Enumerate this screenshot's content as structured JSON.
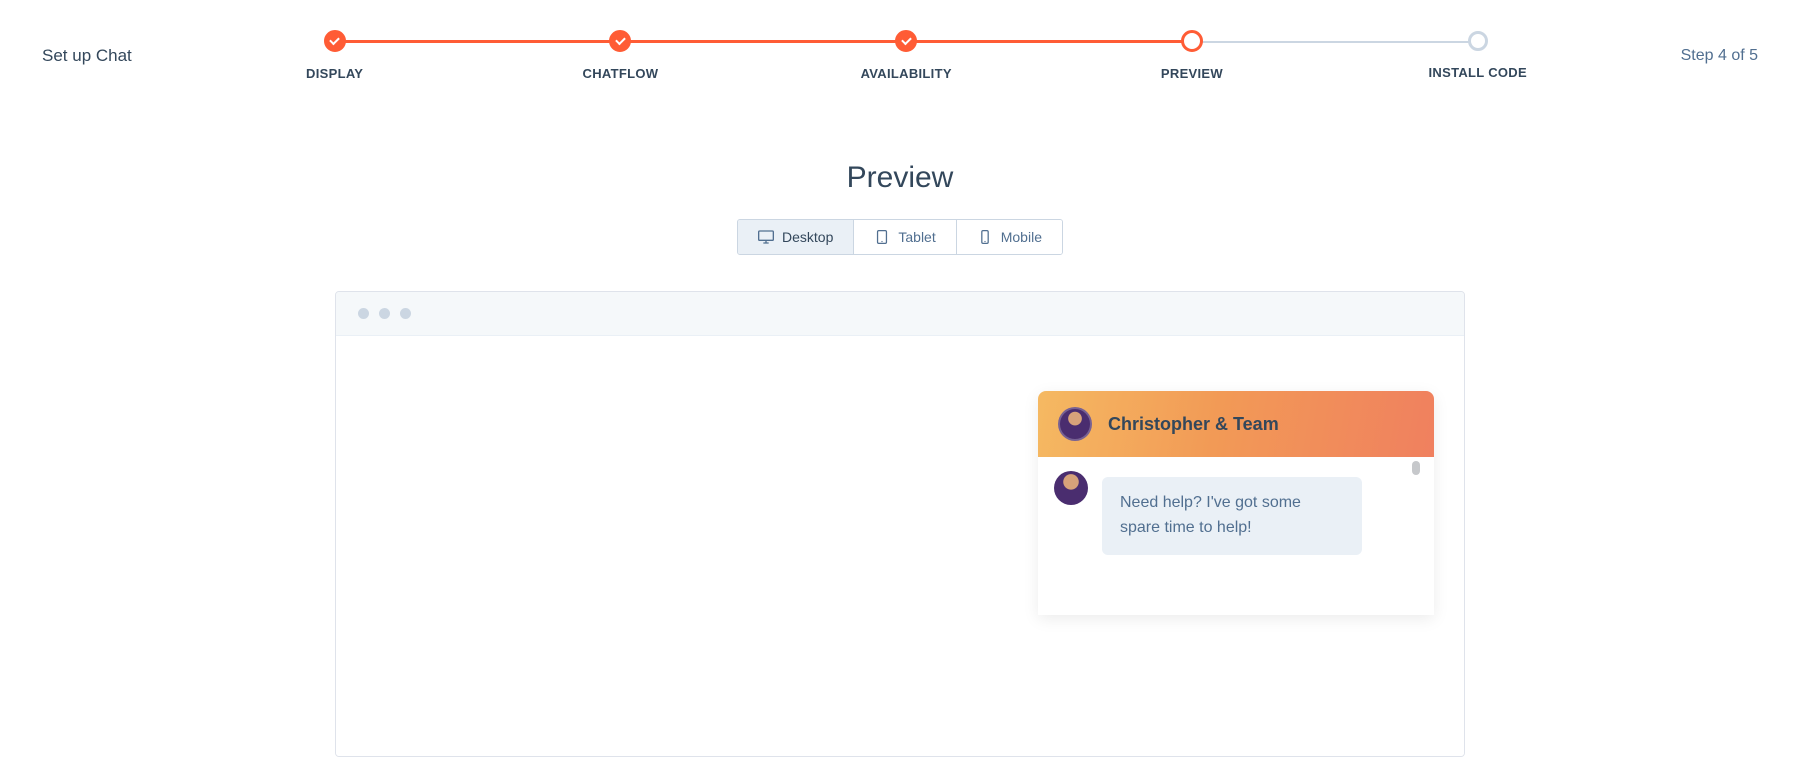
{
  "header": {
    "title": "Set up Chat",
    "step_text": "Step 4 of 5"
  },
  "steps": [
    {
      "label": "DISPLAY",
      "state": "completed"
    },
    {
      "label": "CHATFLOW",
      "state": "completed"
    },
    {
      "label": "AVAILABILITY",
      "state": "completed"
    },
    {
      "label": "PREVIEW",
      "state": "current"
    },
    {
      "label": "INSTALL CODE",
      "state": "future"
    }
  ],
  "preview": {
    "title": "Preview",
    "devices": {
      "desktop": "Desktop",
      "tablet": "Tablet",
      "mobile": "Mobile",
      "active": "desktop"
    }
  },
  "chat": {
    "header_title": "Christopher & Team",
    "message": "Need help? I've got some spare time to help!"
  }
}
